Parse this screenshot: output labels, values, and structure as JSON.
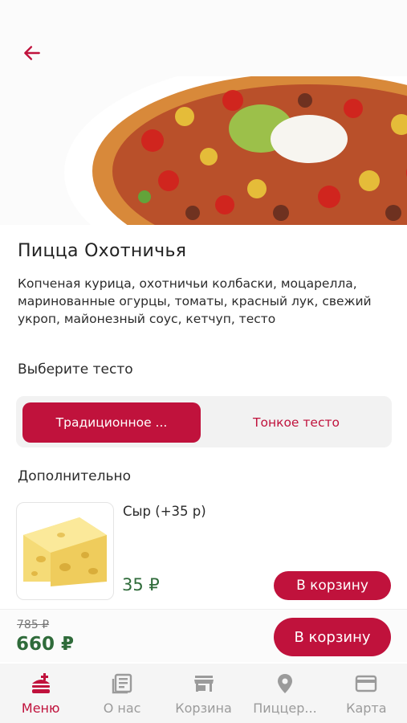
{
  "product": {
    "title": "Пицца Охотничья",
    "description": "Копченая курица, охотничьи колбаски, моцарелла, маринованные огурцы, томаты, красный лук, свежий укроп, майонезный соус, кетчуп, тесто"
  },
  "dough": {
    "label": "Выберите тесто",
    "options": [
      {
        "label": "Традиционное ...",
        "selected": true
      },
      {
        "label": "Тонкое тесто",
        "selected": false
      }
    ]
  },
  "extras": {
    "label": "Дополнительно",
    "items": [
      {
        "name": "Сыр (+35 р)",
        "price": "35 ₽",
        "button": "В корзину",
        "icon": "cheese-image"
      }
    ]
  },
  "footer": {
    "old_price": "785 ₽",
    "price": "660 ₽",
    "button": "В корзину"
  },
  "tabs": [
    {
      "label": "Меню",
      "icon": "menu-burger-icon",
      "active": true
    },
    {
      "label": "О нас",
      "icon": "news-icon",
      "active": false
    },
    {
      "label": "Корзина",
      "icon": "store-icon",
      "active": false
    },
    {
      "label": "Пиццер...",
      "icon": "location-pin-icon",
      "active": false
    },
    {
      "label": "Карта",
      "icon": "card-icon",
      "active": false
    }
  ],
  "colors": {
    "accent": "#c0123c",
    "price_green": "#2f6b3a",
    "inactive_tab": "#9b9b9b"
  }
}
